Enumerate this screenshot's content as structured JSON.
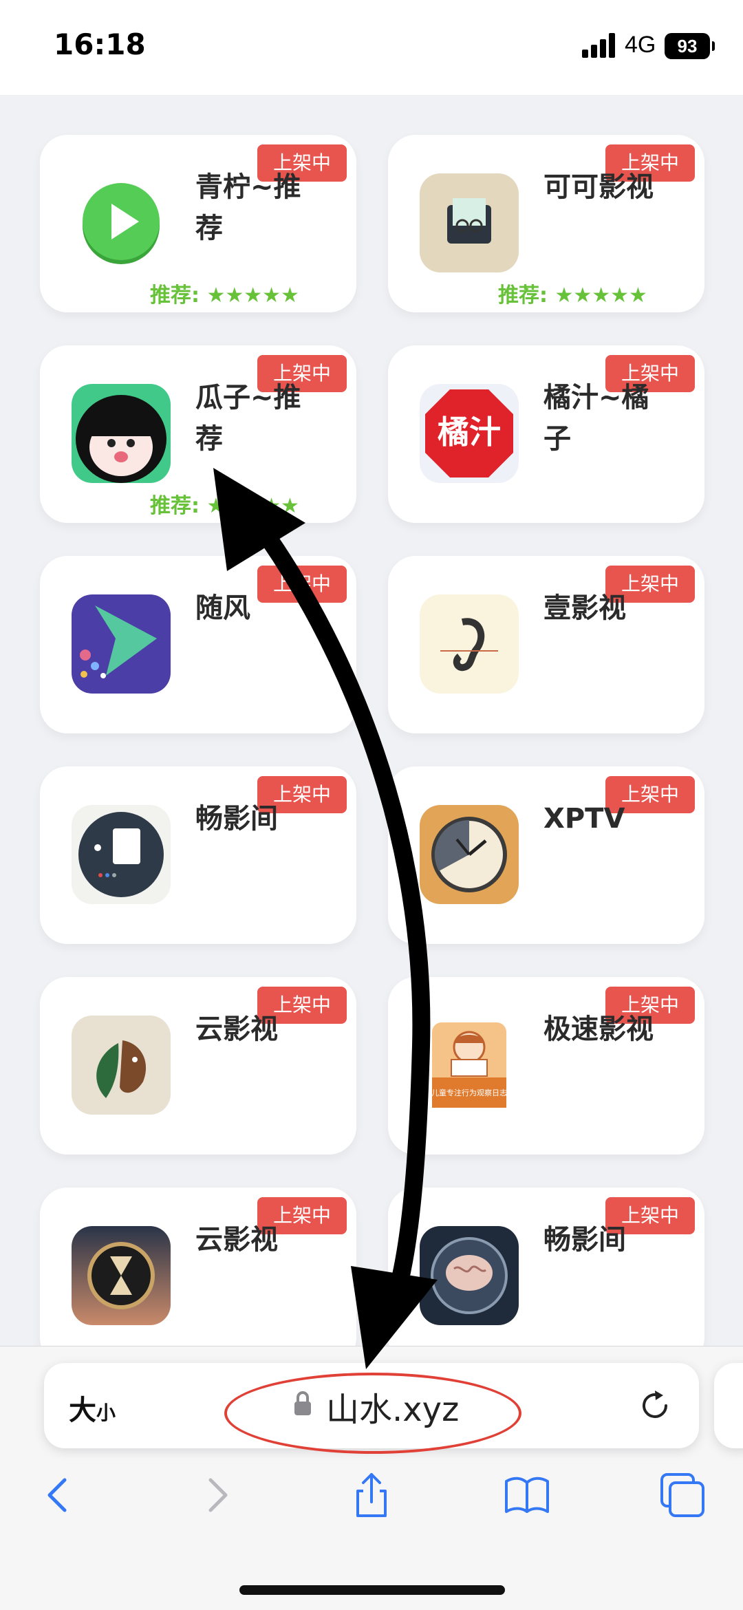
{
  "status_bar": {
    "time": "16:18",
    "network": "4G",
    "battery": "93"
  },
  "cards": [
    {
      "name": "青柠~推荐",
      "badge": "上架中",
      "rating": "推荐: ★★★★★",
      "icon": "green-play-icon"
    },
    {
      "name": "可可影视",
      "badge": "上架中",
      "rating": "推荐: ★★★★★",
      "icon": "glasses-tv-icon"
    },
    {
      "name": "瓜子~推荐",
      "badge": "上架中",
      "rating": "推荐: ★★★★★",
      "icon": "cartoon-face-icon"
    },
    {
      "name": "橘汁~橘子",
      "badge": "上架中",
      "rating": "",
      "icon": "red-octagon-icon",
      "icon_text": "橘汁"
    },
    {
      "name": "随风",
      "badge": "上架中",
      "rating": "",
      "icon": "purple-play-icon"
    },
    {
      "name": "壹影视",
      "badge": "上架中",
      "rating": "",
      "icon": "ear-icon"
    },
    {
      "name": "畅影间",
      "badge": "上架中",
      "rating": "",
      "icon": "document-circle-icon"
    },
    {
      "name": "XPTV",
      "badge": "上架中",
      "rating": "",
      "icon": "clock-icon"
    },
    {
      "name": "云影视",
      "badge": "上架中",
      "rating": "",
      "icon": "leaf-animal-icon"
    },
    {
      "name": "极速影视",
      "badge": "上架中",
      "rating": "",
      "icon": "reading-child-icon",
      "icon_text": "儿童专注行为观察日志"
    },
    {
      "name": "云影视",
      "badge": "上架中",
      "rating": "",
      "icon": "hourglass-icon"
    },
    {
      "name": "畅影间",
      "badge": "上架中",
      "rating": "",
      "icon": "brain-icon"
    }
  ],
  "browser": {
    "text_size_big": "大",
    "text_size_small": "小",
    "url": "山水.xyz"
  },
  "colors": {
    "badge": "#e8554f",
    "rating": "#67c23a",
    "annotation_circle": "#e04036",
    "accent": "#3478f6"
  }
}
